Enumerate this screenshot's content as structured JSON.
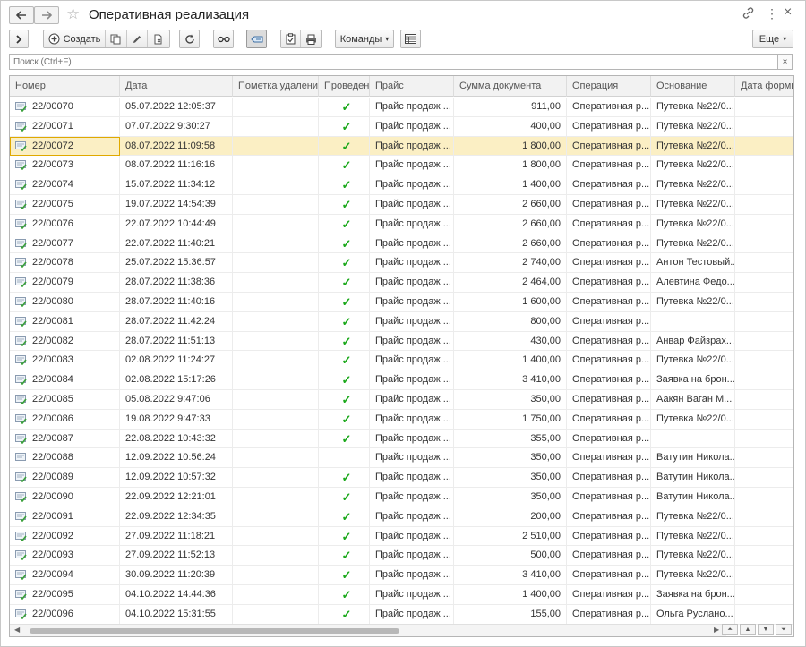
{
  "window": {
    "title": "Оперативная реализация",
    "back_icon": "arrow-left-icon",
    "forward_icon": "arrow-right-icon",
    "favorite_icon": "star-icon",
    "link_icon": "link-icon",
    "menu_icon": "vertical-dots-icon",
    "close_label": "×"
  },
  "toolbar": {
    "create_label": "Создать",
    "commands_label": "Команды",
    "more_label": "Еще",
    "dropdown_glyph": "▾"
  },
  "search": {
    "placeholder": "Поиск (Ctrl+F)",
    "clear_label": "×"
  },
  "table": {
    "columns": [
      "Номер",
      "Дата",
      "Пометка удаления",
      "Проведен",
      "Прайс",
      "Сумма документа",
      "Операция",
      "Основание",
      "Дата формир"
    ],
    "rows": [
      {
        "num": "22/00070",
        "date": "05.07.2022 12:05:37",
        "posted": true,
        "price": "Прайс продаж ...",
        "sum": "911,00",
        "op": "Оперативная р...",
        "basis": "Путевка №22/0..."
      },
      {
        "num": "22/00071",
        "date": "07.07.2022 9:30:27",
        "posted": true,
        "price": "Прайс продаж ...",
        "sum": "400,00",
        "op": "Оперативная р...",
        "basis": "Путевка №22/0..."
      },
      {
        "num": "22/00072",
        "date": "08.07.2022 11:09:58",
        "posted": true,
        "price": "Прайс продаж ...",
        "sum": "1 800,00",
        "op": "Оперативная р...",
        "basis": "Путевка №22/0...",
        "selected": true
      },
      {
        "num": "22/00073",
        "date": "08.07.2022 11:16:16",
        "posted": true,
        "price": "Прайс продаж ...",
        "sum": "1 800,00",
        "op": "Оперативная р...",
        "basis": "Путевка №22/0..."
      },
      {
        "num": "22/00074",
        "date": "15.07.2022 11:34:12",
        "posted": true,
        "price": "Прайс продаж ...",
        "sum": "1 400,00",
        "op": "Оперативная р...",
        "basis": "Путевка №22/0..."
      },
      {
        "num": "22/00075",
        "date": "19.07.2022 14:54:39",
        "posted": true,
        "price": "Прайс продаж ...",
        "sum": "2 660,00",
        "op": "Оперативная р...",
        "basis": "Путевка №22/0..."
      },
      {
        "num": "22/00076",
        "date": "22.07.2022 10:44:49",
        "posted": true,
        "price": "Прайс продаж ...",
        "sum": "2 660,00",
        "op": "Оперативная р...",
        "basis": "Путевка №22/0..."
      },
      {
        "num": "22/00077",
        "date": "22.07.2022 11:40:21",
        "posted": true,
        "price": "Прайс продаж ...",
        "sum": "2 660,00",
        "op": "Оперативная р...",
        "basis": "Путевка №22/0..."
      },
      {
        "num": "22/00078",
        "date": "25.07.2022 15:36:57",
        "posted": true,
        "price": "Прайс продаж ...",
        "sum": "2 740,00",
        "op": "Оперативная р...",
        "basis": "Антон Тестовый..."
      },
      {
        "num": "22/00079",
        "date": "28.07.2022 11:38:36",
        "posted": true,
        "price": "Прайс продаж ...",
        "sum": "2 464,00",
        "op": "Оперативная р...",
        "basis": "Алевтина Федо..."
      },
      {
        "num": "22/00080",
        "date": "28.07.2022 11:40:16",
        "posted": true,
        "price": "Прайс продаж ...",
        "sum": "1 600,00",
        "op": "Оперативная р...",
        "basis": "Путевка №22/0..."
      },
      {
        "num": "22/00081",
        "date": "28.07.2022 11:42:24",
        "posted": true,
        "price": "Прайс продаж ...",
        "sum": "800,00",
        "op": "Оперативная р...",
        "basis": ""
      },
      {
        "num": "22/00082",
        "date": "28.07.2022 11:51:13",
        "posted": true,
        "price": "Прайс продаж ...",
        "sum": "430,00",
        "op": "Оперативная р...",
        "basis": "Анвар Файзрах..."
      },
      {
        "num": "22/00083",
        "date": "02.08.2022 11:24:27",
        "posted": true,
        "price": "Прайс продаж ...",
        "sum": "1 400,00",
        "op": "Оперативная р...",
        "basis": "Путевка №22/0..."
      },
      {
        "num": "22/00084",
        "date": "02.08.2022 15:17:26",
        "posted": true,
        "price": "Прайс продаж ...",
        "sum": "3 410,00",
        "op": "Оперативная р...",
        "basis": "Заявка на брон..."
      },
      {
        "num": "22/00085",
        "date": "05.08.2022 9:47:06",
        "posted": true,
        "price": "Прайс продаж ...",
        "sum": "350,00",
        "op": "Оперативная р...",
        "basis": "Аакян Ваган М..."
      },
      {
        "num": "22/00086",
        "date": "19.08.2022 9:47:33",
        "posted": true,
        "price": "Прайс продаж ...",
        "sum": "1 750,00",
        "op": "Оперативная р...",
        "basis": "Путевка №22/0..."
      },
      {
        "num": "22/00087",
        "date": "22.08.2022 10:43:32",
        "posted": true,
        "price": "Прайс продаж ...",
        "sum": "355,00",
        "op": "Оперативная р...",
        "basis": ""
      },
      {
        "num": "22/00088",
        "date": "12.09.2022 10:56:24",
        "posted": false,
        "price": "Прайс продаж ...",
        "sum": "350,00",
        "op": "Оперативная р...",
        "basis": "Ватутин Никола..."
      },
      {
        "num": "22/00089",
        "date": "12.09.2022 10:57:32",
        "posted": true,
        "price": "Прайс продаж ...",
        "sum": "350,00",
        "op": "Оперативная р...",
        "basis": "Ватутин Никола..."
      },
      {
        "num": "22/00090",
        "date": "22.09.2022 12:21:01",
        "posted": true,
        "price": "Прайс продаж ...",
        "sum": "350,00",
        "op": "Оперативная р...",
        "basis": "Ватутин Никола..."
      },
      {
        "num": "22/00091",
        "date": "22.09.2022 12:34:35",
        "posted": true,
        "price": "Прайс продаж ...",
        "sum": "200,00",
        "op": "Оперативная р...",
        "basis": "Путевка №22/0..."
      },
      {
        "num": "22/00092",
        "date": "27.09.2022 11:18:21",
        "posted": true,
        "price": "Прайс продаж ...",
        "sum": "2 510,00",
        "op": "Оперативная р...",
        "basis": "Путевка №22/0..."
      },
      {
        "num": "22/00093",
        "date": "27.09.2022 11:52:13",
        "posted": true,
        "price": "Прайс продаж ...",
        "sum": "500,00",
        "op": "Оперативная р...",
        "basis": "Путевка №22/0..."
      },
      {
        "num": "22/00094",
        "date": "30.09.2022 11:20:39",
        "posted": true,
        "price": "Прайс продаж ...",
        "sum": "3 410,00",
        "op": "Оперативная р...",
        "basis": "Путевка №22/0..."
      },
      {
        "num": "22/00095",
        "date": "04.10.2022 14:44:36",
        "posted": true,
        "price": "Прайс продаж ...",
        "sum": "1 400,00",
        "op": "Оперативная р...",
        "basis": "Заявка на брон..."
      },
      {
        "num": "22/00096",
        "date": "04.10.2022 15:31:55",
        "posted": true,
        "price": "Прайс продаж ...",
        "sum": "155,00",
        "op": "Оперативная р...",
        "basis": "Ольга Руслано..."
      }
    ]
  },
  "colors": {
    "selected_row": "#fbefc4",
    "check": "#1aa81a",
    "doc_icon_green": "#3aa03a",
    "doc_icon_gray": "#9aa7b5"
  }
}
